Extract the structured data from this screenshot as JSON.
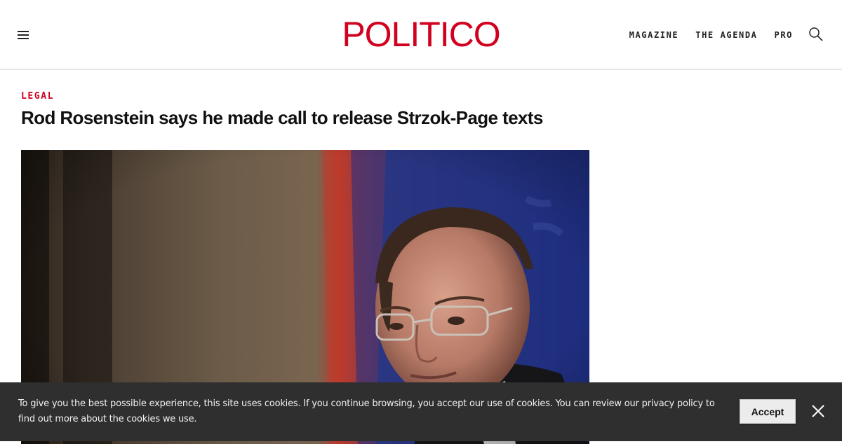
{
  "header": {
    "logo_text": "POLITICO",
    "nav_items": [
      {
        "label": "MAGAZINE"
      },
      {
        "label": "THE AGENDA"
      },
      {
        "label": "PRO"
      }
    ]
  },
  "article": {
    "section": "LEGAL",
    "headline": "Rod Rosenstein says he made call to release Strzok-Page texts"
  },
  "cookie_banner": {
    "message": "To give you the best possible experience, this site uses cookies. If you continue browsing, you accept our use of cookies. You can review our privacy policy to find out more about the cookies we use.",
    "accept_label": "Accept"
  },
  "colors": {
    "brand_red": "#d1001f",
    "banner_bg": "#2f2f2f"
  },
  "icons": [
    "menu-icon",
    "search-icon",
    "close-icon"
  ]
}
